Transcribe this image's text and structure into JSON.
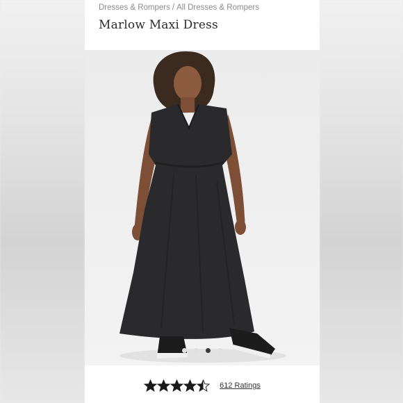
{
  "breadcrumb": {
    "items": [
      "Dresses & Rompers",
      "All Dresses & Rompers"
    ],
    "separator": "/"
  },
  "product": {
    "title": "Marlow Maxi Dress"
  },
  "carousel": {
    "slide_count": 4,
    "active_index": 2
  },
  "rating": {
    "value": 4.5,
    "max": 5,
    "count_label": "612 Ratings"
  },
  "colors": {
    "dress": "#2a2a2c",
    "star": "#1a1a1a",
    "background": "#ffffff"
  }
}
